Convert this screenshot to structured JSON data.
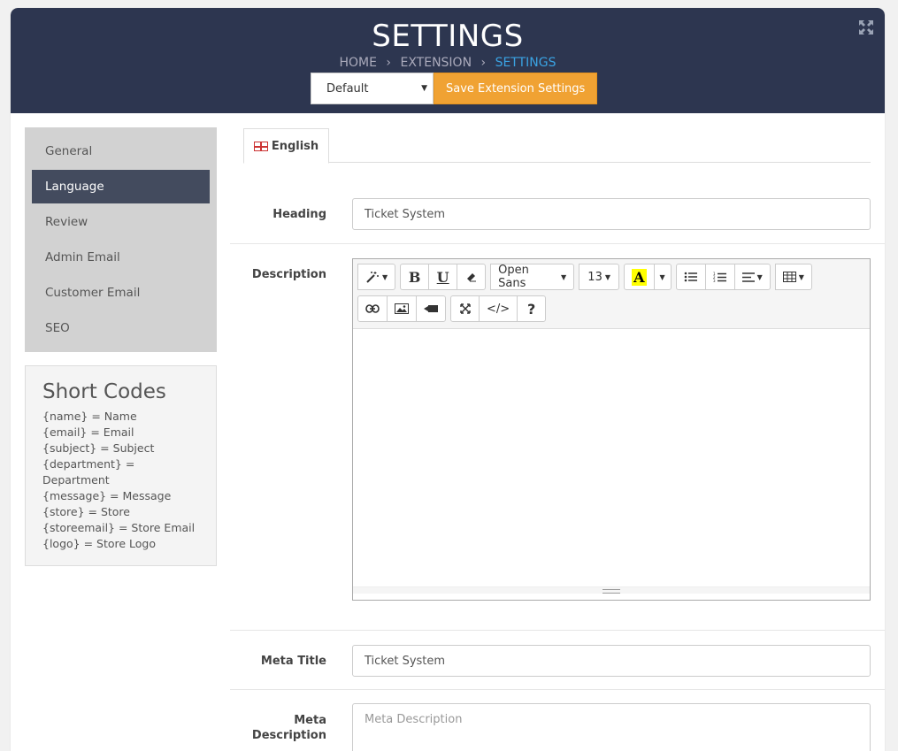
{
  "header": {
    "title": "SETTINGS",
    "breadcrumb": [
      "HOME",
      "EXTENSION",
      "SETTINGS"
    ],
    "store_select": "Default",
    "save_label": "Save Extension Settings"
  },
  "sidebar": {
    "items": [
      {
        "label": "General"
      },
      {
        "label": "Language"
      },
      {
        "label": "Review"
      },
      {
        "label": "Admin Email"
      },
      {
        "label": "Customer Email"
      },
      {
        "label": "SEO"
      }
    ],
    "active_index": 1
  },
  "shortcodes": {
    "title": "Short Codes",
    "items": [
      "{name} = Name",
      "{email} = Email",
      "{subject} = Subject",
      "{department} = Department",
      "{message} = Message",
      "{store} = Store",
      "{storeemail} = Store Email",
      "{logo} = Store Logo"
    ]
  },
  "tabs": [
    {
      "label": "English",
      "active": true
    }
  ],
  "form": {
    "heading": {
      "label": "Heading",
      "value": "Ticket System"
    },
    "description": {
      "label": "Description"
    },
    "meta_title": {
      "label": "Meta Title",
      "value": "Ticket System"
    },
    "meta_description": {
      "label_line1": "Meta",
      "label_line2": "Description",
      "placeholder": "Meta Description"
    }
  },
  "editor": {
    "font_family": "Open Sans",
    "font_size": "13",
    "color_letter": "A",
    "bold_letter": "B",
    "underline_letter": "U",
    "help_glyph": "?",
    "code_glyph": "</>"
  }
}
